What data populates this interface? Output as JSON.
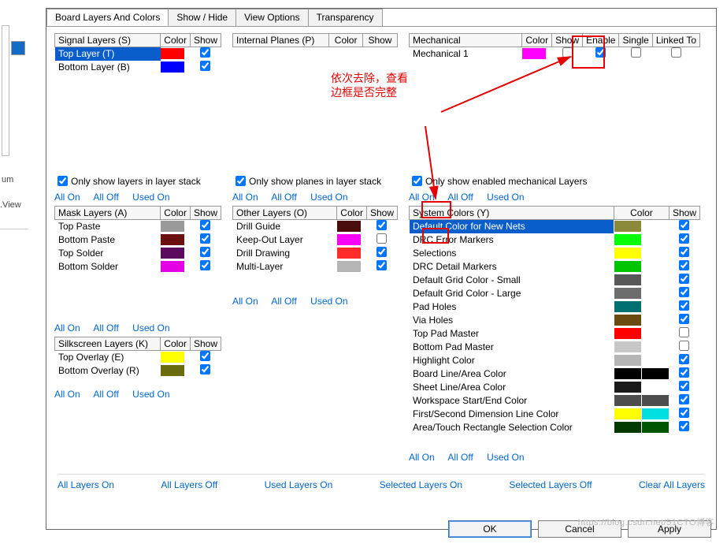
{
  "tabs": [
    {
      "label": "Board Layers And Colors",
      "active": true
    },
    {
      "label": "Show / Hide",
      "active": false
    },
    {
      "label": "View Options",
      "active": false
    },
    {
      "label": "Transparency",
      "active": false
    }
  ],
  "linkbar": {
    "all_on": "All On",
    "all_off": "All Off",
    "used_on": "Used On"
  },
  "only_layers": "Only show layers in layer stack",
  "only_planes": "Only show planes in layer stack",
  "only_mech": "Only show enabled mechanical Layers",
  "signal": {
    "header": {
      "name": "Signal Layers (S)",
      "color": "Color",
      "show": "Show"
    },
    "rows": [
      {
        "name": "Top Layer (T)",
        "color": "#ff0000",
        "show": true,
        "selected": true
      },
      {
        "name": "Bottom Layer (B)",
        "color": "#0000ff",
        "show": true,
        "selected": false
      }
    ]
  },
  "planes": {
    "header": {
      "name": "Internal Planes (P)",
      "color": "Color",
      "show": "Show"
    }
  },
  "mech": {
    "header": {
      "name": "Mechanical",
      "color": "Color",
      "show": "Show",
      "enable": "Enable",
      "single": "Single",
      "linked": "Linked To"
    },
    "rows": [
      {
        "name": "Mechanical 1",
        "color": "#ff00ff",
        "show": false,
        "enable": true,
        "single": false,
        "linked": false
      }
    ]
  },
  "mask": {
    "header": {
      "name": "Mask Layers (A)",
      "color": "Color",
      "show": "Show"
    },
    "rows": [
      {
        "name": "Top Paste",
        "color": "#9a9a9a",
        "show": true
      },
      {
        "name": "Bottom Paste",
        "color": "#6b1010",
        "show": true
      },
      {
        "name": "Top Solder",
        "color": "#5b0b5b",
        "show": true
      },
      {
        "name": "Bottom Solder",
        "color": "#e400e4",
        "show": true
      }
    ]
  },
  "other": {
    "header": {
      "name": "Other Layers (O)",
      "color": "Color",
      "show": "Show"
    },
    "rows": [
      {
        "name": "Drill Guide",
        "color": "#4a0d0d",
        "show": true
      },
      {
        "name": "Keep-Out Layer",
        "color": "#ff00ff",
        "show": false
      },
      {
        "name": "Drill Drawing",
        "color": "#ff2a2a",
        "show": true
      },
      {
        "name": "Multi-Layer",
        "color": "#b5b5b5",
        "show": true
      }
    ]
  },
  "silk": {
    "header": {
      "name": "Silkscreen Layers (K)",
      "color": "Color",
      "show": "Show"
    },
    "rows": [
      {
        "name": "Top Overlay (E)",
        "color": "#ffff00",
        "show": true
      },
      {
        "name": "Bottom Overlay (R)",
        "color": "#6b6b10",
        "show": true
      }
    ]
  },
  "system": {
    "header": {
      "name": "System Colors (Y)",
      "color": "Color",
      "show": "Show"
    },
    "rows": [
      {
        "name": "Default Color for New Nets",
        "c1": "#8a8a3a",
        "c2": null,
        "show": true,
        "selected": true
      },
      {
        "name": "DRC Error Markers",
        "c1": "#00ff00",
        "c2": null,
        "show": true
      },
      {
        "name": "Selections",
        "c1": "#ffff00",
        "c2": null,
        "show": true
      },
      {
        "name": "DRC Detail Markers",
        "c1": "#00c400",
        "c2": null,
        "show": true
      },
      {
        "name": "Default Grid Color - Small",
        "c1": "#585858",
        "c2": null,
        "show": true
      },
      {
        "name": "Default Grid Color - Large",
        "c1": "#6d6d6d",
        "c2": null,
        "show": true
      },
      {
        "name": "Pad Holes",
        "c1": "#007070",
        "c2": null,
        "show": true
      },
      {
        "name": "Via Holes",
        "c1": "#6b4a10",
        "c2": null,
        "show": true
      },
      {
        "name": "Top Pad Master",
        "c1": "#ff0000",
        "c2": null,
        "show": false
      },
      {
        "name": "Bottom Pad Master",
        "c1": "#c7c7c7",
        "c2": null,
        "show": false
      },
      {
        "name": "Highlight Color",
        "c1": "#b5b5b5",
        "c2": null,
        "show": true
      },
      {
        "name": "Board Line/Area Color",
        "c1": "#000000",
        "c2": "#000000",
        "show": true
      },
      {
        "name": "Sheet Line/Area Color",
        "c1": "#1a1a1a",
        "c2": null,
        "show": true
      },
      {
        "name": "Workspace Start/End Color",
        "c1": "#4d4d4d",
        "c2": "#4d4d4d",
        "show": true
      },
      {
        "name": "First/Second Dimension Line Color",
        "c1": "#ffff00",
        "c2": "#00e0e0",
        "show": true
      },
      {
        "name": "Area/Touch Rectangle Selection Color",
        "c1": "#003a00",
        "c2": "#005500",
        "show": true
      }
    ]
  },
  "bottom": {
    "all_on": "All Layers On",
    "all_off": "All Layers Off",
    "used_on": "Used Layers On",
    "sel_on": "Selected Layers On",
    "sel_off": "Selected Layers Off",
    "clear": "Clear All Layers"
  },
  "buttons": {
    "ok": "OK",
    "cancel": "Cancel",
    "apply": "Apply"
  },
  "annotation": {
    "line1": "依次去除，查看",
    "line2": "边框是否完整"
  },
  "left_artifacts": {
    "um": "um",
    "view": ".View"
  }
}
